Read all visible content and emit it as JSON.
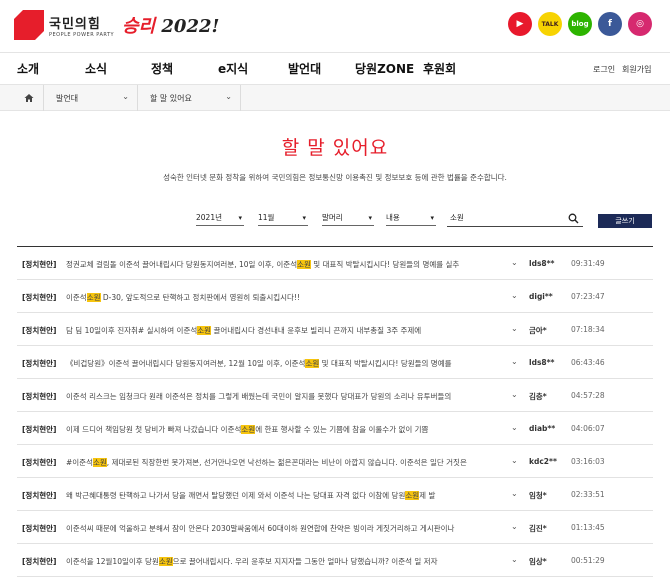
{
  "header": {
    "logo_name": "국민의힘",
    "logo_sub": "PEOPLE POWER PARTY",
    "slogan_a": "승리 ",
    "slogan_b": "2022!",
    "social": [
      {
        "name": "youtube-icon",
        "label": "▶",
        "color": "#e8192c"
      },
      {
        "name": "kakao-icon",
        "label": "TALK",
        "color": "#f7d302"
      },
      {
        "name": "blog-icon",
        "label": "blog",
        "color": "#2db400"
      },
      {
        "name": "facebook-icon",
        "label": "f",
        "color": "#3b5998"
      },
      {
        "name": "instagram-icon",
        "label": "◎",
        "color": "#d6296f"
      }
    ]
  },
  "nav": {
    "items": [
      "소개",
      "소식",
      "정책",
      "e지식",
      "발언대",
      "당원ZONE",
      "후원회"
    ],
    "login": "로그인",
    "join": "회원가입"
  },
  "breadcrumb": {
    "level1": "발언대",
    "level2": "할 말 있어요"
  },
  "page": {
    "title": "할 말 있어요",
    "description": "성숙한 인터넷 문화 정착을 위하여 국민의힘은 정보통신망 이용촉진 및 정보보호 등에 관한 법률을 준수합니다."
  },
  "filters": {
    "year": "2021년",
    "month": "11월",
    "head": "말머리",
    "field": "내용",
    "query": "소원",
    "write_label": "글쓰기"
  },
  "posts": [
    {
      "category": "[정치현안]",
      "pre": "정권교체 걸림돌 이준석 끌어내립시다 당원동지여러분, 10일 이후, 이준석",
      "hl": "소원",
      "post": " 및 대표직 박탈시킵시다! 당원들의 명예를 실추",
      "author": "lds8**",
      "time": "09:31:49"
    },
    {
      "category": "[정치현안]",
      "pre": "이준석",
      "hl": "소원",
      "post": " D-30, 앞도적으로 탄핵하고 정치판에서 영원히 퇴출시킵시다!!",
      "author": "digi**",
      "time": "07:23:47"
    },
    {
      "category": "[정치현안]",
      "pre": "담 딤 10일이후 진자취# 실시하여 이준석",
      "hl": "소원",
      "post": " 끌어내립시다 경선내내 윤후보 빌리니 끈까지 내부총질 3주 주제에",
      "author": "금아*",
      "time": "07:18:34"
    },
    {
      "category": "[정치현안]",
      "pre": "《비겁당원》이준석 끌어내립시다 당원동지여러분, 12월 10일 이후, 이준석",
      "hl": "소원",
      "post": " 및 대표직 박탈시킵시다! 당원들의 명예를",
      "author": "lds8**",
      "time": "06:43:46"
    },
    {
      "category": "[정치현안]",
      "pre": "이준석 리스크는 임청크다 원래 이준석은 정치를 그렇게 배웠는데 국민이 알지를 못했다 당대표가 당원의 소리나 유투버들의",
      "hl": "",
      "post": "",
      "author": "김층*",
      "time": "04:57:28"
    },
    {
      "category": "[정치현안]",
      "pre": "이제 드디어 책임당원 첫 당비가 빠져 나갔습니다 이준석",
      "hl": "소원",
      "post": "에 한표 행사할 수 있는 기쁨에 참을 이룰수가 없이 기쁨",
      "author": "diab**",
      "time": "04:06:07"
    },
    {
      "category": "[정치현안]",
      "pre": "#이준석",
      "hl": "소원",
      "post": ", 제대로된 직장한번 못가져본, 선거만나오면 낙선하는 젊은꼰대라는 비난이 아깝지 않습니다. 이준석은 일단 거짓은",
      "author": "kdc2**",
      "time": "03:16:03"
    },
    {
      "category": "[정치현안]",
      "pre": "왜 박근혜대통령 탄핵하고 나가서 당을 깨면서 탈당했던 이제 와서 이준석 나는 당대표 자격 없다 이참에 당원",
      "hl": "소원",
      "post": "제 발",
      "author": "임청*",
      "time": "02:33:51"
    },
    {
      "category": "[정치현안]",
      "pre": "이준석씨 때문에 억울하고 분해서 잠이 안온다 2030말싸움에서 60대이하 원연합에 찬약은 빙이라 게짓거리하고 게시판이나",
      "hl": "",
      "post": "",
      "author": "김진*",
      "time": "01:13:45"
    },
    {
      "category": "[정치현안]",
      "pre": "이준석을 12월10일이후 당원",
      "hl": "소원",
      "post": "으로 끌어내립시다. 우리 윤후보 지지자들 그동안 얼마나 당했습니까? 이준석 일 저자",
      "author": "임상*",
      "time": "00:51:29"
    }
  ]
}
